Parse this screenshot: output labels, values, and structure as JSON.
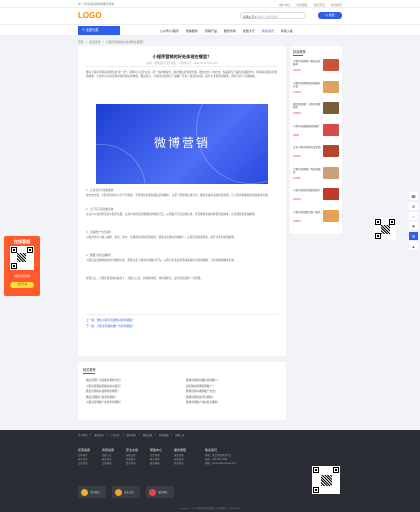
{
  "topbar": {
    "left_text": "中一天在线营销机构服务导航",
    "links": [
      "用户中心",
      "交易保障",
      "社区首页",
      "新闻资讯"
    ]
  },
  "header": {
    "logo": "LOGO",
    "search_select": "营销公司 ▾",
    "search_placeholder": "请输入关键词搜索",
    "search_button": "Q 搜索"
  },
  "nav": {
    "all_categories": "☰ 全部分类",
    "items": [
      "公众号/小程序",
      "微信服务",
      "营销产品",
      "服务市场",
      "优质大厅",
      "新闻资讯",
      "商家入驻"
    ],
    "active_index": 5
  },
  "breadcrumb": [
    "首页",
    ">",
    "新闻资讯",
    ">",
    "小程序营销的好处体现在哪里？"
  ],
  "article": {
    "title": "小程序营销的好处体现在哪里？",
    "meta": "来源：微博营销    浏览次数：1    发布时间：2020-12-17 09:41:09",
    "intro": "微信小程序营销就是微信在\"第一屏\"，同样可以让企业在，同一用户体验中，通过微信的营销方案，微信支付，在社交，在品牌与产品的营销服务中，能够获得更高的营销效率，让用户可以在营销中获得更好的体验，相比而言，小程序给营销与产品推广带来了更多的价值，提升企业的营销效果，同时节约了营销成本。",
    "banner_text": "微博营销",
    "paras": [
      "1、让社交分享更加便捷",
      "在社交方面，小程序的用户分享十分便捷，不管你是在朋友圈还是群聊中，只需一键就能完成分享，微信生态带来的社交流量，让小程序传播变得更加简单有效。",
      "2、让门店引流更加高效",
      "企业可以通过附近的小程序功能，让用户在附近就能够找到你的门店，从而提升门店的到店率，并且能够有效的降低获客成本，让营销变得更加精准。",
      "3、营销推广方式多样",
      "小程序中可以植入拼团、秒杀、砍价、优惠券等多种营销插件，帮助企业做好营销推广，从而实现流量转化，提升企业的营销效率。",
      "4、数据分析更加精准",
      "小程序后台能够提供用户数据分析，帮助企业了解用户画像与行为，从而为企业的营销决策提供可靠的依据，让营销更加精准有效。",
      "总而言之，小程序营销的好处在于：流量入口多、获客成本低、转化效率高，是企业营销的一大利器。"
    ],
    "prev": "上一篇：微信小程序营销的好处有哪些？",
    "next": "下一篇：小程序营销的推广方式有哪些？"
  },
  "sidebar": {
    "heading": "精品推荐",
    "items": [
      {
        "title": "小程序营销推广解决方案服务",
        "price": "¥3200"
      },
      {
        "title": "小程序营销策划运营服务方案",
        "price": "¥1500"
      },
      {
        "title": "微信营销推广小程序开发制作",
        "price": "¥2800"
      },
      {
        "title": "小程序商城搭建营销推广",
        "price": "¥980"
      },
      {
        "title": "企业小程序营销方案定制",
        "price": "¥2000"
      },
      {
        "title": "小程序营销推广代运营服务",
        "price": "¥1680"
      },
      {
        "title": "小程序营销活动策划执行",
        "price": "¥3600"
      },
      {
        "title": "小程序营销整合推广服务",
        "price": "¥4800"
      }
    ],
    "thumb_colors": [
      "#c8543a",
      "#e0a260",
      "#7a5c3a",
      "#d94b4b",
      "#b6452c",
      "#caa07a",
      "#c0392b",
      "#e5a154"
    ]
  },
  "related": {
    "heading": "相关推荐",
    "left": [
      "微信营销广告投放有哪些方式？",
      "小程序营销如何做好用户运营？",
      "微信营销的好处体现在哪里？",
      "微信营销推广渠道有哪些？",
      "小程序营销推广的优势有哪些？"
    ],
    "right": [
      "微博营销如何做好营销推广？",
      "如何做好微博营销推广？",
      "微博营销有哪些推广方式？",
      "微博营销的技巧有哪些？",
      "微博营销推广的好处有哪些？"
    ]
  },
  "floater": {
    "heading": "在线客服",
    "sub": "微信扫码咨询",
    "button": "立即咨询"
  },
  "footer": {
    "nav": [
      "关于我们",
      "|",
      "服务协议",
      "|",
      "广告合作",
      "|",
      "联系我们",
      "|",
      "隐私政策",
      "|",
      "网站地图",
      "|",
      "商家入驻"
    ],
    "columns": [
      {
        "heading": "买家指南",
        "items": [
          "如何购买",
          "发布需求",
          "交易流程"
        ]
      },
      {
        "heading": "商家指南",
        "items": [
          "商家入驻",
          "服务发布",
          "交易规则"
        ]
      },
      {
        "heading": "安全交易",
        "items": [
          "担保交易",
          "防骗指南",
          "投诉举报"
        ]
      },
      {
        "heading": "帮助中心",
        "items": [
          "常见问题",
          "账号管理",
          "联系客服"
        ]
      },
      {
        "heading": "服务保障",
        "items": [
          "退款说明",
          "纠纷处理",
          "服务承诺"
        ]
      }
    ],
    "contact": {
      "heading": "联系我们",
      "lines": [
        "客服：微信营销服务平台",
        "电话：400-000-0000",
        "邮箱：service@example.com"
      ]
    },
    "badges": [
      "可信网站",
      "安全认证",
      "诚信网站"
    ],
    "copyright": "Copyright © 2020 微博营销 版权所有  ICP备案号：00000000号"
  },
  "tools": [
    "☎",
    "✉",
    "⌂",
    "⚑",
    "☰",
    "▲"
  ]
}
